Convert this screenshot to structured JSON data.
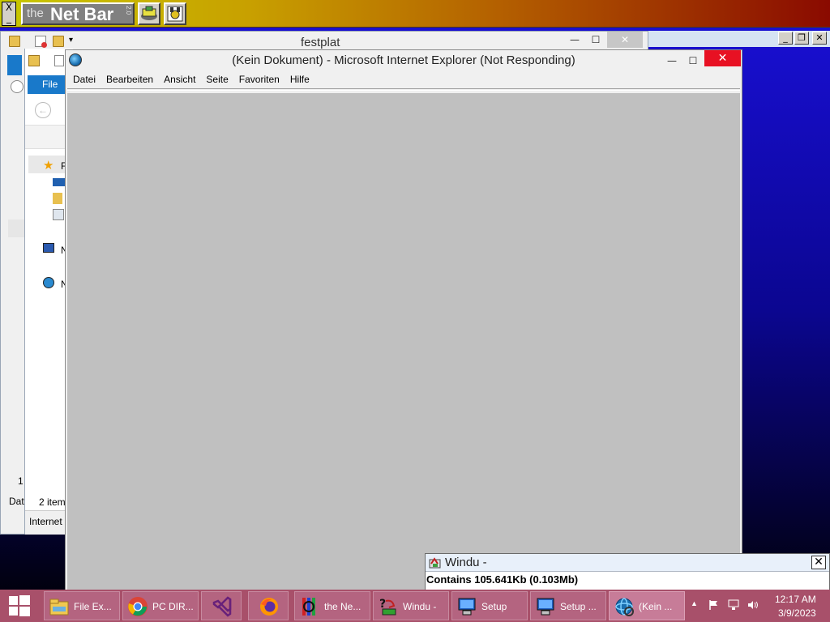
{
  "netbar": {
    "close_glyph": "X",
    "logo_the": "the",
    "logo_name": "Net Bar",
    "logo_version": "2.0",
    "buttons": [
      "network-tool-icon",
      "settings-tool-icon"
    ]
  },
  "festplat_window": {
    "title": "festplat",
    "min_glyph": "—",
    "max_glyph": "☐",
    "close_glyph": "✕",
    "file_tab": "File",
    "side_labels": [
      "F",
      "N",
      "N"
    ],
    "status_count": "2 item",
    "status_left_1": "1",
    "status_left_2": "Dat",
    "status_bottom": "Internet"
  },
  "background_window": {
    "min_glyph": "_",
    "restore_glyph": "❐",
    "close_glyph": "✕"
  },
  "ie_window": {
    "title": "(Kein Dokument) - Microsoft Internet Explorer (Not Responding)",
    "min_glyph": "—",
    "max_glyph": "☐",
    "close_glyph": "✕",
    "menu": [
      "Datei",
      "Bearbeiten",
      "Ansicht",
      "Seite",
      "Favoriten",
      "Hilfe"
    ]
  },
  "windu_popup": {
    "title": "Windu -",
    "close_glyph": "✕",
    "message": "Contains 105.641Kb (0.103Mb)"
  },
  "taskbar": {
    "tasks": [
      {
        "label": "File Ex...",
        "icon": "file-explorer-icon"
      },
      {
        "label": "PC DIR...",
        "icon": "chrome-icon"
      },
      {
        "label": "",
        "icon": "visual-studio-icon"
      },
      {
        "label": "",
        "icon": "firefox-icon"
      },
      {
        "label": "the Ne...",
        "icon": "netbar-icon"
      },
      {
        "label": "Windu -",
        "icon": "windu-icon"
      },
      {
        "label": "Setup",
        "icon": "setup-icon"
      },
      {
        "label": "Setup ...",
        "icon": "setup-icon"
      },
      {
        "label": "(Kein ...",
        "icon": "internet-explorer-icon"
      }
    ],
    "tray": {
      "time": "12:17 AM",
      "date": "3/9/2023",
      "show_hidden_glyph": "▲"
    }
  },
  "colors": {
    "desktop": "#0b0690",
    "taskbar": "#a8506a",
    "ie_close": "#e81123",
    "ie_content": "#c0c0c0"
  }
}
